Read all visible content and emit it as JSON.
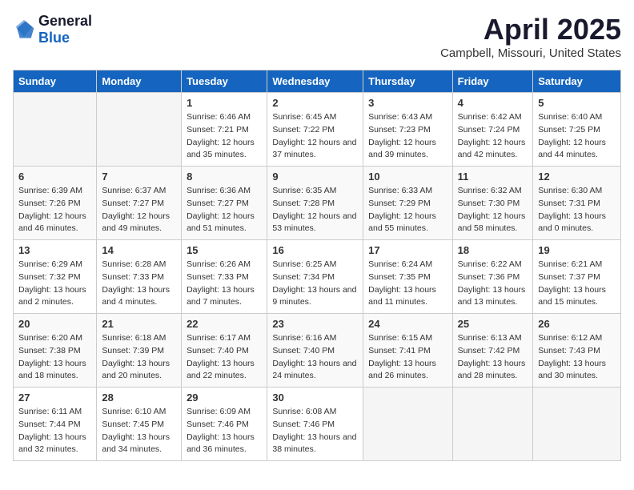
{
  "logo": {
    "general": "General",
    "blue": "Blue"
  },
  "title": "April 2025",
  "subtitle": "Campbell, Missouri, United States",
  "days_header": [
    "Sunday",
    "Monday",
    "Tuesday",
    "Wednesday",
    "Thursday",
    "Friday",
    "Saturday"
  ],
  "weeks": [
    [
      {
        "num": "",
        "empty": true
      },
      {
        "num": "",
        "empty": true
      },
      {
        "num": "1",
        "sunrise": "Sunrise: 6:46 AM",
        "sunset": "Sunset: 7:21 PM",
        "daylight": "Daylight: 12 hours and 35 minutes."
      },
      {
        "num": "2",
        "sunrise": "Sunrise: 6:45 AM",
        "sunset": "Sunset: 7:22 PM",
        "daylight": "Daylight: 12 hours and 37 minutes."
      },
      {
        "num": "3",
        "sunrise": "Sunrise: 6:43 AM",
        "sunset": "Sunset: 7:23 PM",
        "daylight": "Daylight: 12 hours and 39 minutes."
      },
      {
        "num": "4",
        "sunrise": "Sunrise: 6:42 AM",
        "sunset": "Sunset: 7:24 PM",
        "daylight": "Daylight: 12 hours and 42 minutes."
      },
      {
        "num": "5",
        "sunrise": "Sunrise: 6:40 AM",
        "sunset": "Sunset: 7:25 PM",
        "daylight": "Daylight: 12 hours and 44 minutes."
      }
    ],
    [
      {
        "num": "6",
        "sunrise": "Sunrise: 6:39 AM",
        "sunset": "Sunset: 7:26 PM",
        "daylight": "Daylight: 12 hours and 46 minutes."
      },
      {
        "num": "7",
        "sunrise": "Sunrise: 6:37 AM",
        "sunset": "Sunset: 7:27 PM",
        "daylight": "Daylight: 12 hours and 49 minutes."
      },
      {
        "num": "8",
        "sunrise": "Sunrise: 6:36 AM",
        "sunset": "Sunset: 7:27 PM",
        "daylight": "Daylight: 12 hours and 51 minutes."
      },
      {
        "num": "9",
        "sunrise": "Sunrise: 6:35 AM",
        "sunset": "Sunset: 7:28 PM",
        "daylight": "Daylight: 12 hours and 53 minutes."
      },
      {
        "num": "10",
        "sunrise": "Sunrise: 6:33 AM",
        "sunset": "Sunset: 7:29 PM",
        "daylight": "Daylight: 12 hours and 55 minutes."
      },
      {
        "num": "11",
        "sunrise": "Sunrise: 6:32 AM",
        "sunset": "Sunset: 7:30 PM",
        "daylight": "Daylight: 12 hours and 58 minutes."
      },
      {
        "num": "12",
        "sunrise": "Sunrise: 6:30 AM",
        "sunset": "Sunset: 7:31 PM",
        "daylight": "Daylight: 13 hours and 0 minutes."
      }
    ],
    [
      {
        "num": "13",
        "sunrise": "Sunrise: 6:29 AM",
        "sunset": "Sunset: 7:32 PM",
        "daylight": "Daylight: 13 hours and 2 minutes."
      },
      {
        "num": "14",
        "sunrise": "Sunrise: 6:28 AM",
        "sunset": "Sunset: 7:33 PM",
        "daylight": "Daylight: 13 hours and 4 minutes."
      },
      {
        "num": "15",
        "sunrise": "Sunrise: 6:26 AM",
        "sunset": "Sunset: 7:33 PM",
        "daylight": "Daylight: 13 hours and 7 minutes."
      },
      {
        "num": "16",
        "sunrise": "Sunrise: 6:25 AM",
        "sunset": "Sunset: 7:34 PM",
        "daylight": "Daylight: 13 hours and 9 minutes."
      },
      {
        "num": "17",
        "sunrise": "Sunrise: 6:24 AM",
        "sunset": "Sunset: 7:35 PM",
        "daylight": "Daylight: 13 hours and 11 minutes."
      },
      {
        "num": "18",
        "sunrise": "Sunrise: 6:22 AM",
        "sunset": "Sunset: 7:36 PM",
        "daylight": "Daylight: 13 hours and 13 minutes."
      },
      {
        "num": "19",
        "sunrise": "Sunrise: 6:21 AM",
        "sunset": "Sunset: 7:37 PM",
        "daylight": "Daylight: 13 hours and 15 minutes."
      }
    ],
    [
      {
        "num": "20",
        "sunrise": "Sunrise: 6:20 AM",
        "sunset": "Sunset: 7:38 PM",
        "daylight": "Daylight: 13 hours and 18 minutes."
      },
      {
        "num": "21",
        "sunrise": "Sunrise: 6:18 AM",
        "sunset": "Sunset: 7:39 PM",
        "daylight": "Daylight: 13 hours and 20 minutes."
      },
      {
        "num": "22",
        "sunrise": "Sunrise: 6:17 AM",
        "sunset": "Sunset: 7:40 PM",
        "daylight": "Daylight: 13 hours and 22 minutes."
      },
      {
        "num": "23",
        "sunrise": "Sunrise: 6:16 AM",
        "sunset": "Sunset: 7:40 PM",
        "daylight": "Daylight: 13 hours and 24 minutes."
      },
      {
        "num": "24",
        "sunrise": "Sunrise: 6:15 AM",
        "sunset": "Sunset: 7:41 PM",
        "daylight": "Daylight: 13 hours and 26 minutes."
      },
      {
        "num": "25",
        "sunrise": "Sunrise: 6:13 AM",
        "sunset": "Sunset: 7:42 PM",
        "daylight": "Daylight: 13 hours and 28 minutes."
      },
      {
        "num": "26",
        "sunrise": "Sunrise: 6:12 AM",
        "sunset": "Sunset: 7:43 PM",
        "daylight": "Daylight: 13 hours and 30 minutes."
      }
    ],
    [
      {
        "num": "27",
        "sunrise": "Sunrise: 6:11 AM",
        "sunset": "Sunset: 7:44 PM",
        "daylight": "Daylight: 13 hours and 32 minutes."
      },
      {
        "num": "28",
        "sunrise": "Sunrise: 6:10 AM",
        "sunset": "Sunset: 7:45 PM",
        "daylight": "Daylight: 13 hours and 34 minutes."
      },
      {
        "num": "29",
        "sunrise": "Sunrise: 6:09 AM",
        "sunset": "Sunset: 7:46 PM",
        "daylight": "Daylight: 13 hours and 36 minutes."
      },
      {
        "num": "30",
        "sunrise": "Sunrise: 6:08 AM",
        "sunset": "Sunset: 7:46 PM",
        "daylight": "Daylight: 13 hours and 38 minutes."
      },
      {
        "num": "",
        "empty": true
      },
      {
        "num": "",
        "empty": true
      },
      {
        "num": "",
        "empty": true
      }
    ]
  ]
}
